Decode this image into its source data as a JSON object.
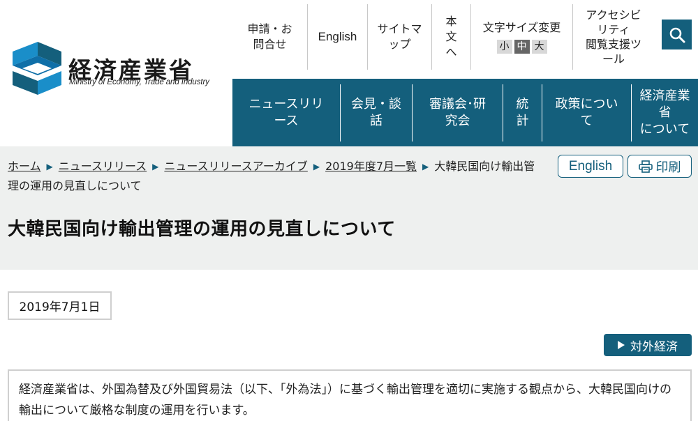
{
  "header": {
    "logo": {
      "name_ja": "経済産業省",
      "name_en": "Ministry of Economy, Trade and Industry"
    },
    "utility": {
      "apply_contact": [
        "申請・お",
        "問合せ"
      ],
      "english": "English",
      "sitemap": [
        "サイトマ",
        "ップ"
      ],
      "body_text": [
        "本",
        "文",
        "へ"
      ],
      "font_size": {
        "label": "文字サイズ変更",
        "small": "小",
        "medium": "中",
        "large": "大",
        "selected": "中"
      },
      "accessibility": [
        "アクセシビ",
        "リティ",
        "閲覧支援ツ",
        "ール"
      ]
    },
    "nav": {
      "news": [
        "ニュースリリ",
        "ース"
      ],
      "press": [
        "会見・談",
        "話"
      ],
      "council": [
        "審議会･研",
        "究会"
      ],
      "stats": [
        "統",
        "計"
      ],
      "policy": [
        "政策につい",
        "て"
      ],
      "about": [
        "経済産業",
        "省",
        "について"
      ]
    }
  },
  "breadcrumb": {
    "items": [
      "ホーム",
      "ニュースリリース",
      "ニュースリリースアーカイブ",
      "2019年度7月一覧"
    ],
    "current": "大韓民国向け輸出管理の運用の見直しについて",
    "separator": "▶"
  },
  "actions": {
    "english": "English",
    "print": "印刷"
  },
  "page": {
    "title": "大韓民国向け輸出管理の運用の見直しについて",
    "date": "2019年7月1日",
    "category": "対外経済",
    "summary": "経済産業省は、外国為替及び外国貿易法（以下、「外為法」）に基づく輸出管理を適切に実施する観点から、大韓民国向けの輸出について厳格な制度の運用を行います。"
  },
  "colors": {
    "primary": "#145f7c",
    "band": "#eef0ef",
    "logo_blue": "#1a8ec9",
    "logo_dark": "#145f7c"
  }
}
